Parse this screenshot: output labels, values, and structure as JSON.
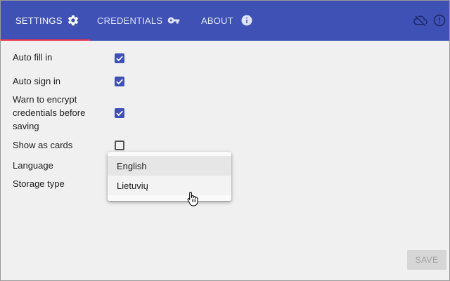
{
  "tabs": [
    {
      "label": "SETTINGS",
      "icon": "gear-icon",
      "active": true
    },
    {
      "label": "CREDENTIALS",
      "icon": "key-icon",
      "active": false
    },
    {
      "label": "ABOUT",
      "icon": "info-icon",
      "active": false
    }
  ],
  "appbar_icons": [
    "cloud-off-icon",
    "alert-icon"
  ],
  "settings": {
    "auto_fill": {
      "label": "Auto fill in",
      "checked": true
    },
    "auto_sign": {
      "label": "Auto sign in",
      "checked": true
    },
    "warn_encrypt": {
      "label_lines": [
        "Warn to encrypt",
        "credentials before",
        "saving"
      ],
      "checked": true
    },
    "show_cards": {
      "label": "Show as cards",
      "checked": false
    },
    "language": {
      "label": "Language"
    },
    "storage": {
      "label": "Storage type"
    }
  },
  "language_menu": {
    "options": [
      "English",
      "Lietuvių"
    ],
    "selected": "English",
    "hovered": "Lietuvių"
  },
  "save_button": {
    "label": "SAVE",
    "enabled": false
  },
  "colors": {
    "appbar": "#3f51b5",
    "tab_indicator": "#e8344e",
    "checkbox": "#3f51b5",
    "background": "#f0f0f0"
  }
}
